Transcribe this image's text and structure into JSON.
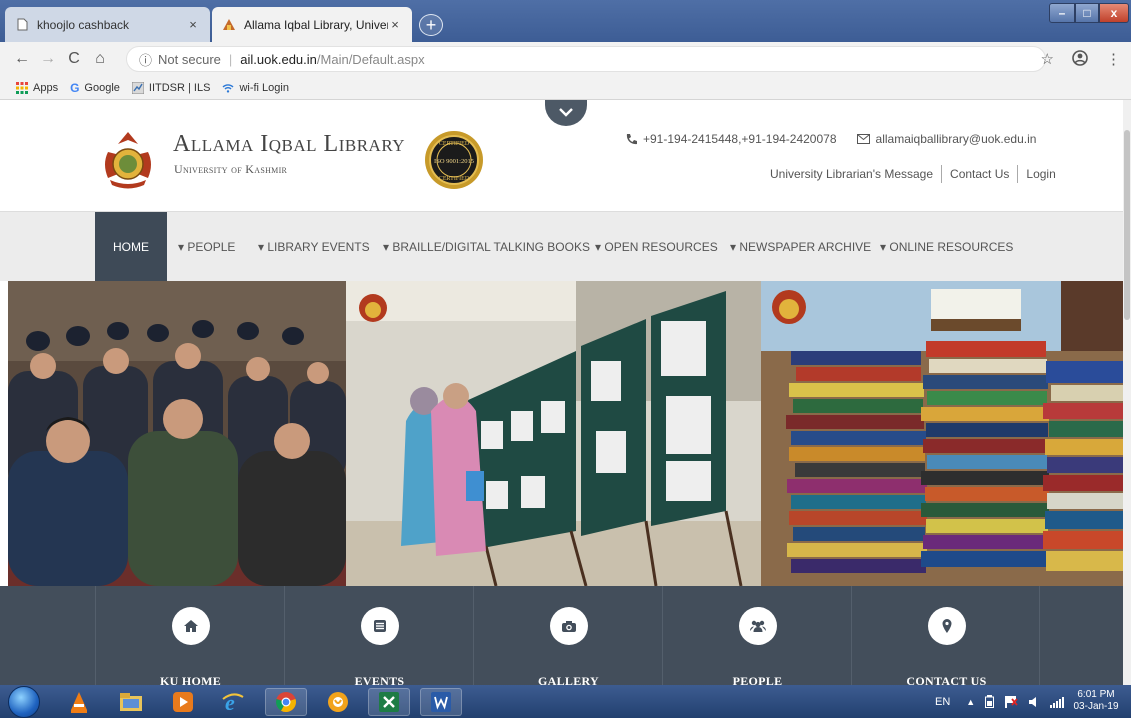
{
  "browser": {
    "tabs": [
      {
        "title": "khoojlo cashback",
        "close": "×"
      },
      {
        "title": "Allama Iqbal Library, University o",
        "close": "×"
      }
    ],
    "new_tab": "+",
    "window_controls": {
      "minimize": "–",
      "maximize": "□",
      "close": "x"
    },
    "address": {
      "security": "Not secure",
      "host": "ail.uok.edu.in",
      "path": "/Main/Default.aspx"
    },
    "bookmarks": [
      {
        "label": "Apps",
        "icon": "apps-grid-icon"
      },
      {
        "label": "Google",
        "icon": "google-icon"
      },
      {
        "label": "IITDSR | ILS",
        "icon": "iitdsr-icon"
      },
      {
        "label": "wi-fi Login",
        "icon": "wifi-icon"
      }
    ]
  },
  "site": {
    "title": "Allama Iqbal Library",
    "subtitle": "University of Kashmir",
    "iso_badge": {
      "top": "CERTIFIED",
      "middle": "ISO 9001:2015",
      "bottom": "CERTIFIED"
    },
    "phone": "+91-194-2415448,+91-194-2420078",
    "email": "allamaiqballibrary@uok.edu.in",
    "top_links": [
      "University Librarian's Message",
      "Contact Us",
      "Login"
    ],
    "menu": [
      {
        "label": "HOME",
        "active": true
      },
      {
        "label": "▾ PEOPLE"
      },
      {
        "label": "▾ LIBRARY EVENTS"
      },
      {
        "label": "▾ BRAILLE/DIGITAL TALKING BOOKS"
      },
      {
        "label": "▾ OPEN RESOURCES"
      },
      {
        "label": "▾ NEWSPAPER ARCHIVE"
      },
      {
        "label": "▾ ONLINE RESOURCES"
      }
    ],
    "features": [
      {
        "label": "KU HOME",
        "icon": "home-icon"
      },
      {
        "label": "EVENTS",
        "icon": "events-icon"
      },
      {
        "label": "GALLERY",
        "icon": "camera-icon"
      },
      {
        "label": "PEOPLE",
        "icon": "people-icon"
      },
      {
        "label": "CONTACT US",
        "icon": "map-marker-icon"
      }
    ],
    "colors": {
      "menu_active": "#3e4a57",
      "features_bg": "#434e5b",
      "menu_bg": "#ececec"
    }
  },
  "taskbar": {
    "language": "EN",
    "time": "6:01 PM",
    "date": "03-Jan-19"
  }
}
